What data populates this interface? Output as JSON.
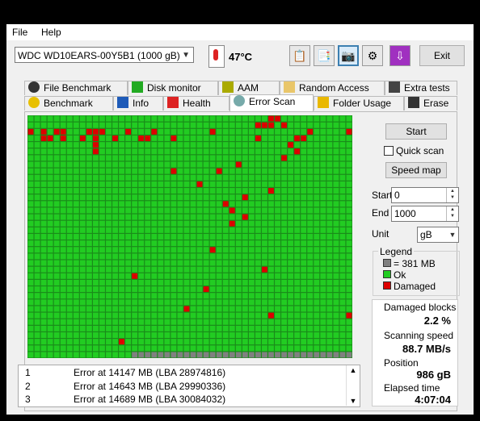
{
  "menu": {
    "file": "File",
    "help": "Help"
  },
  "toolbar": {
    "drive": "WDC WD10EARS-00Y5B1 (1000 gB)",
    "temperature": "47°C",
    "exit_label": "Exit"
  },
  "tabs_row1": [
    "File Benchmark",
    "Disk monitor",
    "AAM",
    "Random Access",
    "Extra tests"
  ],
  "tabs_row2": [
    "Benchmark",
    "Info",
    "Health",
    "Error Scan",
    "Folder Usage",
    "Erase"
  ],
  "active_tab": "Error Scan",
  "controls": {
    "start_button": "Start",
    "quick_scan_label": "Quick scan",
    "quick_scan_checked": false,
    "speed_map_button": "Speed map",
    "start_label": "Start",
    "start_value": "0",
    "end_label": "End",
    "end_value": "1000",
    "unit_label": "Unit",
    "unit_value": "gB"
  },
  "legend": {
    "title": "Legend",
    "block_size": "= 381 MB",
    "ok": "Ok",
    "damaged": "Damaged",
    "colors": {
      "ok": "#22cc22",
      "damaged": "#dd0000",
      "pending": "#808080"
    }
  },
  "stats": {
    "damaged_blocks_label": "Damaged blocks",
    "damaged_blocks_value": "2.2 %",
    "scanning_speed_label": "Scanning speed",
    "scanning_speed_value": "88.7 MB/s",
    "position_label": "Position",
    "position_value": "986 gB",
    "elapsed_label": "Elapsed time",
    "elapsed_value": "4:07:04"
  },
  "log": [
    {
      "n": "1",
      "text": "Error at 14147 MB (LBA 28974816)"
    },
    {
      "n": "2",
      "text": "Error at 14643 MB (LBA 29990336)"
    },
    {
      "n": "3",
      "text": "Error at 14689 MB (LBA 30084032)"
    }
  ],
  "grid": {
    "cols": 50,
    "rows": 37,
    "pending_from_index": 1816,
    "damaged": [
      [
        37,
        0
      ],
      [
        38,
        0
      ],
      [
        35,
        1
      ],
      [
        36,
        1
      ],
      [
        37,
        1
      ],
      [
        39,
        1
      ],
      [
        0,
        2
      ],
      [
        2,
        2
      ],
      [
        4,
        2
      ],
      [
        5,
        2
      ],
      [
        9,
        2
      ],
      [
        10,
        2
      ],
      [
        11,
        2
      ],
      [
        15,
        2
      ],
      [
        19,
        2
      ],
      [
        28,
        2
      ],
      [
        43,
        2
      ],
      [
        49,
        2
      ],
      [
        2,
        3
      ],
      [
        3,
        3
      ],
      [
        5,
        3
      ],
      [
        8,
        3
      ],
      [
        10,
        3
      ],
      [
        13,
        3
      ],
      [
        17,
        3
      ],
      [
        18,
        3
      ],
      [
        22,
        3
      ],
      [
        35,
        3
      ],
      [
        41,
        3
      ],
      [
        42,
        3
      ],
      [
        10,
        4
      ],
      [
        40,
        4
      ],
      [
        10,
        5
      ],
      [
        41,
        5
      ],
      [
        39,
        6
      ],
      [
        32,
        7
      ],
      [
        22,
        8
      ],
      [
        29,
        8
      ],
      [
        26,
        10
      ],
      [
        37,
        11
      ],
      [
        33,
        12
      ],
      [
        30,
        13
      ],
      [
        31,
        14
      ],
      [
        33,
        15
      ],
      [
        31,
        16
      ],
      [
        28,
        20
      ],
      [
        36,
        23
      ],
      [
        16,
        24
      ],
      [
        27,
        26
      ],
      [
        24,
        29
      ],
      [
        37,
        30
      ],
      [
        49,
        30
      ],
      [
        14,
        34
      ]
    ]
  }
}
